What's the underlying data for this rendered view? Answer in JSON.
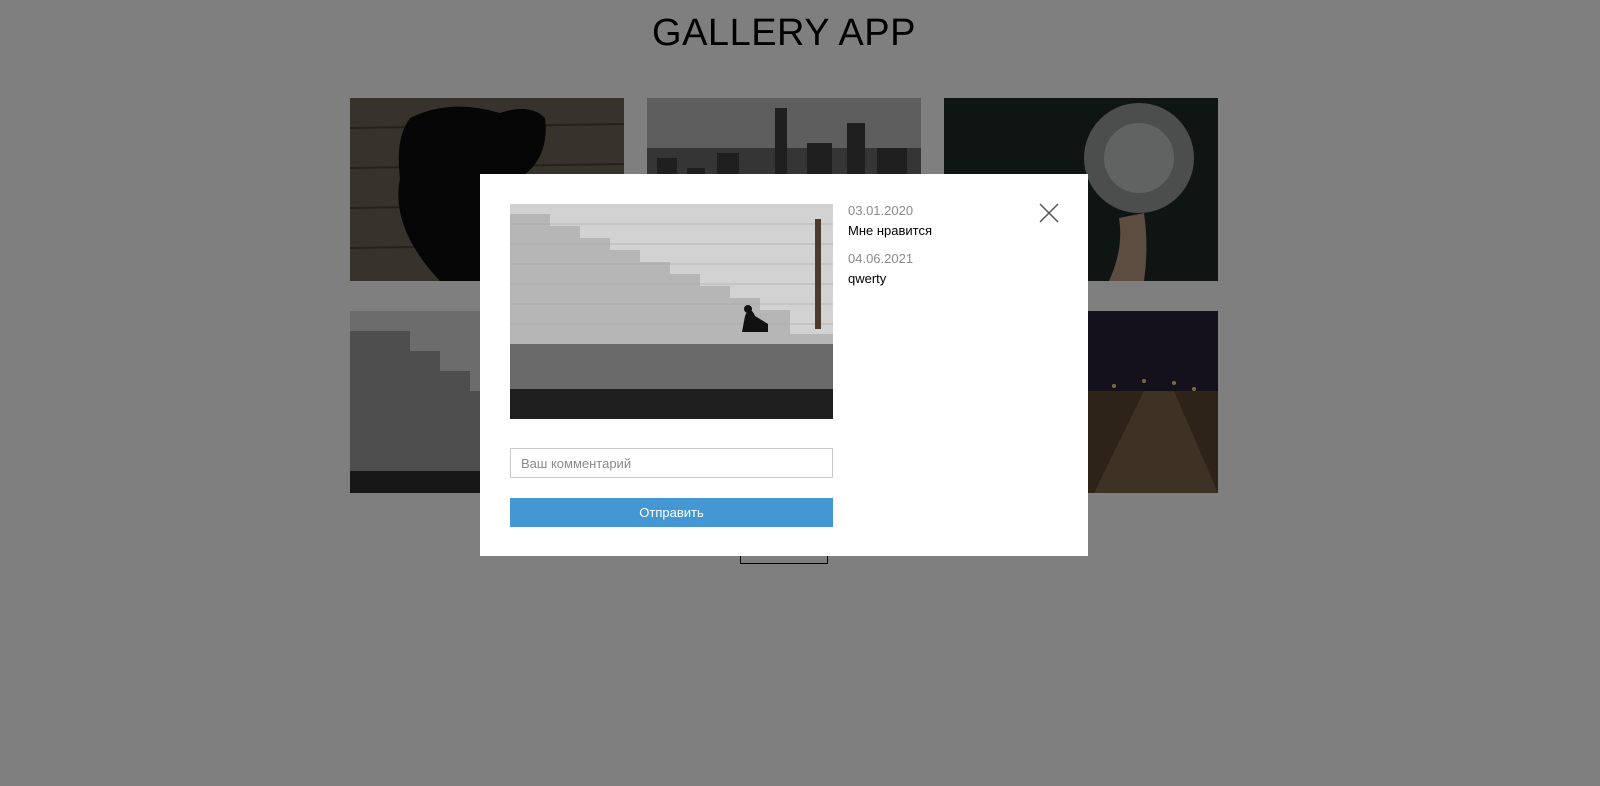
{
  "app": {
    "title": "GALLERY APP"
  },
  "gallery": {
    "thumbnails": [
      {
        "icon": "dog-photo"
      },
      {
        "icon": "city-skyline-photo"
      },
      {
        "icon": "dandelion-photo"
      },
      {
        "icon": "stone-stairs-photo"
      },
      {
        "icon": "dark-photo"
      },
      {
        "icon": "night-road-photo"
      }
    ]
  },
  "modal": {
    "image_icon": "stone-stairs-photo",
    "comments": [
      {
        "date": "03.01.2020",
        "text": "Мне нравится"
      },
      {
        "date": "04.06.2021",
        "text": "qwerty"
      }
    ],
    "comment_input": {
      "placeholder": "Ваш комментарий",
      "value": ""
    },
    "submit_label": "Отправить",
    "close_icon": "close-icon"
  },
  "colors": {
    "overlay": "rgba(0,0,0,0.5)",
    "accent": "#4597d3",
    "date_text": "#8a8a8a"
  }
}
